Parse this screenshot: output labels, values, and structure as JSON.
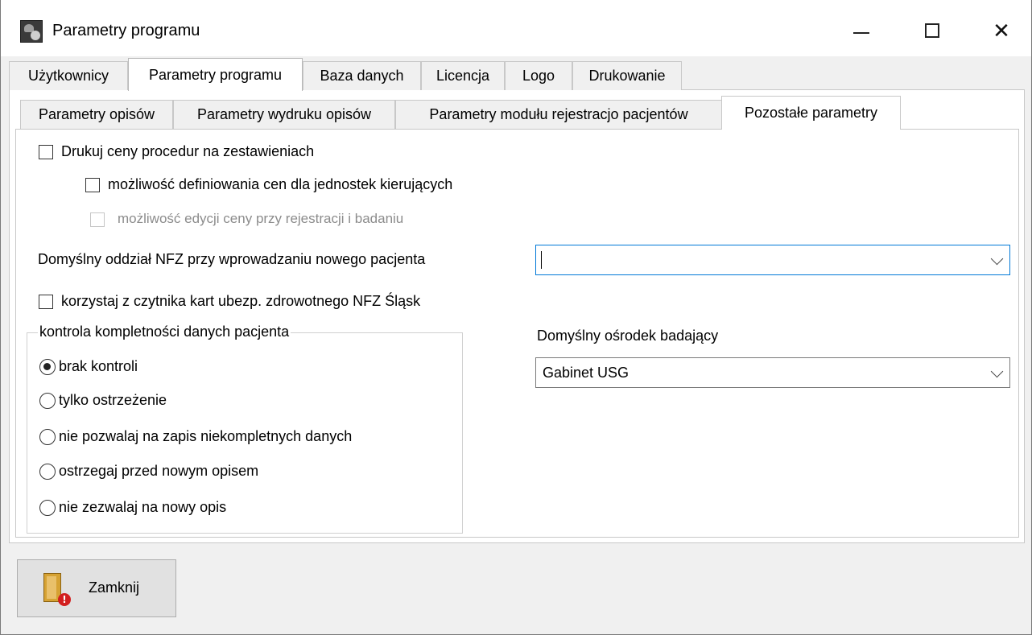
{
  "window": {
    "title": "Parametry programu",
    "icon": "app-icon",
    "controls": {
      "minimize": "minimize-icon",
      "maximize": "maximize-icon",
      "close": "close-icon"
    }
  },
  "main_tabs": [
    {
      "label": "Użytkownicy",
      "active": false
    },
    {
      "label": "Parametry programu",
      "active": true
    },
    {
      "label": "Baza danych",
      "active": false
    },
    {
      "label": "Licencja",
      "active": false
    },
    {
      "label": "Logo",
      "active": false
    },
    {
      "label": "Drukowanie",
      "active": false
    }
  ],
  "sub_tabs": [
    {
      "label": "Parametry opisów",
      "active": false
    },
    {
      "label": "Parametry wydruku opisów",
      "active": false
    },
    {
      "label": "Parametry modułu rejestracjo pacjentów",
      "active": false
    },
    {
      "label": "Pozostałe parametry",
      "active": true
    }
  ],
  "options": {
    "print_prices": {
      "label": "Drukuj ceny procedur na zestawieniach",
      "checked": false,
      "enabled": true
    },
    "define_prices": {
      "label": "możliwość definiowania cen dla jednostek kierujących",
      "checked": false,
      "enabled": true
    },
    "edit_price": {
      "label": "możliwość edycji ceny przy rejestracji i badaniu",
      "checked": false,
      "enabled": false
    },
    "default_nfz_label": "Domyślny oddział NFZ przy wprowadzaniu nowego pacjenta",
    "default_nfz_value": "",
    "card_reader": {
      "label": "korzystaj z czytnika kart ubezp. zdrowotnego NFZ Śląsk",
      "checked": false,
      "enabled": true
    }
  },
  "completeness_group": {
    "title": "kontrola kompletności danych pacjenta",
    "options": [
      {
        "label": "brak kontroli",
        "checked": true
      },
      {
        "label": "tylko ostrzeżenie",
        "checked": false
      },
      {
        "label": "nie pozwalaj na zapis niekompletnych danych",
        "checked": false
      },
      {
        "label": "ostrzegaj przed nowym opisem",
        "checked": false
      },
      {
        "label": "nie zezwalaj na nowy opis",
        "checked": false
      }
    ]
  },
  "default_center": {
    "label": "Domyślny ośrodek badający",
    "value": "Gabinet USG"
  },
  "footer": {
    "close_label": "Zamknij",
    "close_icon": "door-exit-icon"
  }
}
